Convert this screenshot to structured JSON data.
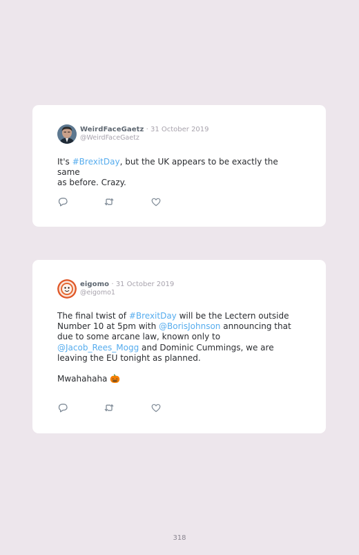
{
  "tweets": [
    {
      "author_name": "WeirdFaceGaetz",
      "date": "31 October 2019",
      "handle": "@WeirdFaceGaetz",
      "body": {
        "lines": [
          [
            {
              "t": "It's "
            },
            {
              "t": "#BrexitDay",
              "tag": true
            },
            {
              "t": ", but the UK appears to be exactly the same"
            }
          ],
          [
            {
              "t": "as before. Crazy."
            }
          ]
        ]
      }
    },
    {
      "author_name": "eigomo",
      "date": "31 October 2019",
      "handle": "@eigomo1",
      "body": {
        "lines": [
          [
            {
              "t": "The final twist of "
            },
            {
              "t": "#BrexitDay",
              "tag": true
            },
            {
              "t": " will be the Lectern outside"
            }
          ],
          [
            {
              "t": "Number 10 at 5pm with "
            },
            {
              "t": "@BorisJohnson",
              "tag": true
            },
            {
              "t": " announcing that"
            }
          ],
          [
            {
              "t": "due to some arcane law, known only to"
            }
          ],
          [
            {
              "t": "@Jacob_Rees_Mogg",
              "tag": true
            },
            {
              "t": " and Dominic Cummings, we are"
            }
          ],
          [
            {
              "t": "leaving the EU tonight as planned."
            }
          ],
          [],
          [
            {
              "t": "Mwahahaha 🎃"
            }
          ]
        ]
      }
    }
  ],
  "page_number": "318",
  "colors": {
    "background": "#ede6ec",
    "card": "#ffffff",
    "link": "#55acee",
    "muted": "#a7a2ac",
    "icon": "#7e8a96"
  },
  "icons": [
    "reply-icon",
    "retweet-icon",
    "like-icon"
  ]
}
